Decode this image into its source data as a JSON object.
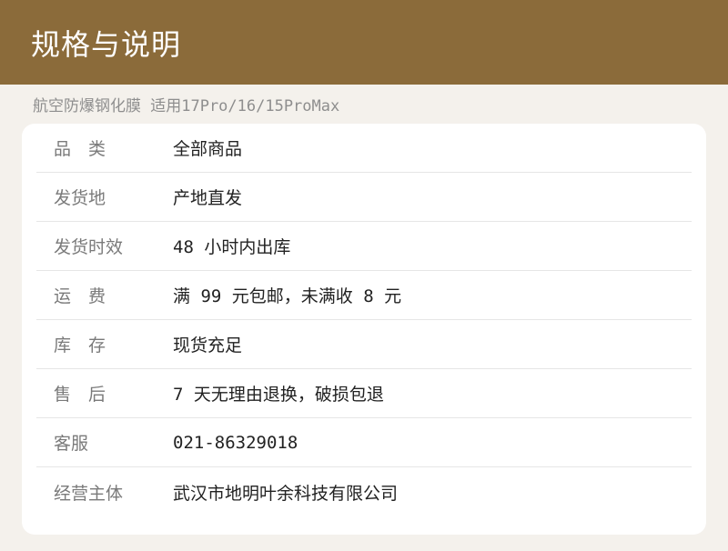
{
  "header": {
    "title": "规格与说明"
  },
  "subtitle": "航空防爆钢化膜 适用17Pro/16/15ProMax",
  "specs": [
    {
      "label": "品　类",
      "value": "全部商品"
    },
    {
      "label": "发货地",
      "value": "产地直发"
    },
    {
      "label": "发货时效",
      "value": "48 小时内出库"
    },
    {
      "label": "运　费",
      "value": "满 99 元包邮，未满收 8 元"
    },
    {
      "label": "库　存",
      "value": "现货充足"
    },
    {
      "label": "售　后",
      "value": "7 天无理由退换，破损包退"
    },
    {
      "label": "客服",
      "value": "021-86329018"
    },
    {
      "label": "经营主体",
      "value": "武汉市地明叶余科技有限公司"
    }
  ],
  "colors": {
    "header_bg": "#8b6b3a",
    "page_bg": "#f4f1ec"
  }
}
